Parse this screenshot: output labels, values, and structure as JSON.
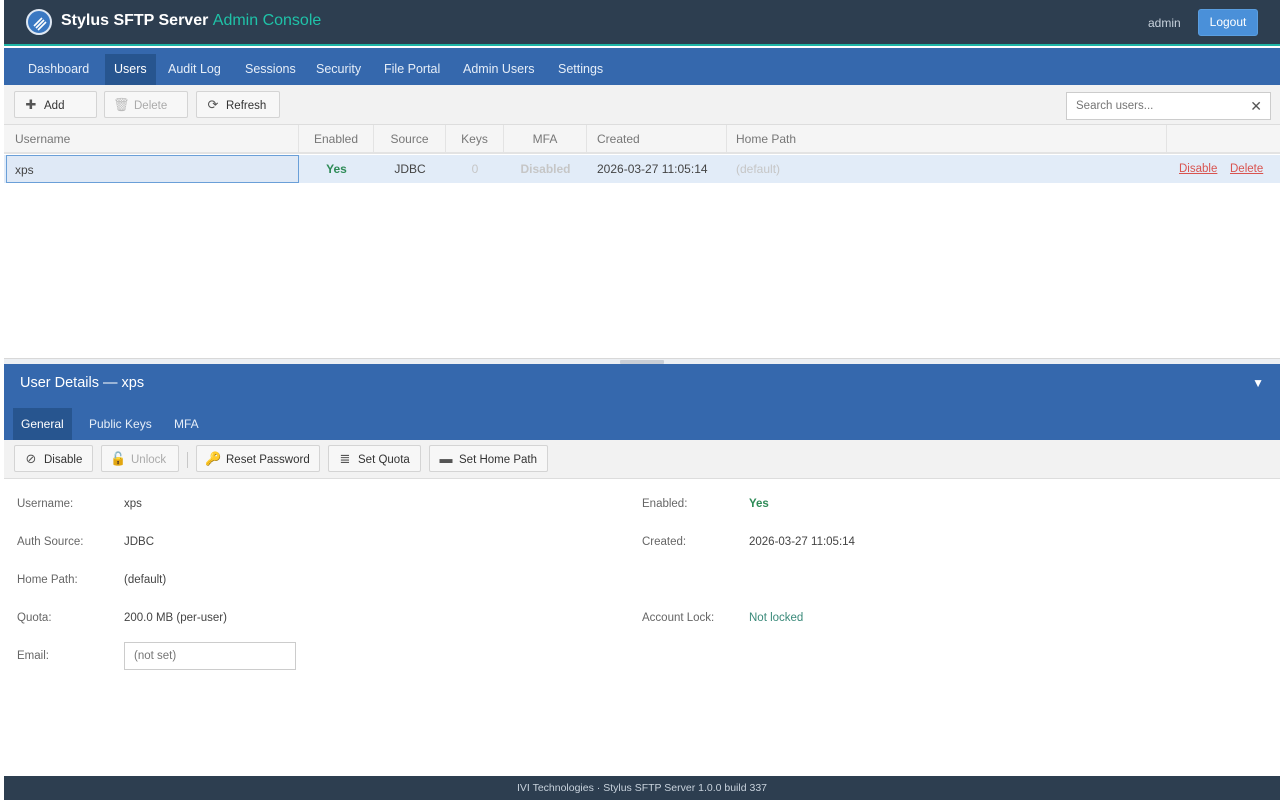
{
  "header": {
    "title": "Stylus SFTP Server",
    "subtitle": "Admin Console",
    "user": "admin",
    "logout_label": "Logout",
    "logo_icon": "sftp-logo-icon"
  },
  "nav": {
    "tabs": [
      {
        "label": "Dashboard"
      },
      {
        "label": "Users",
        "active": true
      },
      {
        "label": "Audit Log"
      },
      {
        "label": "Sessions"
      },
      {
        "label": "Security"
      },
      {
        "label": "File Portal"
      },
      {
        "label": "Admin Users"
      },
      {
        "label": "Settings"
      }
    ]
  },
  "toolbar": {
    "add_label": "Add",
    "delete_label": "Delete",
    "refresh_label": "Refresh",
    "search_placeholder": "Search users...",
    "search_value": ""
  },
  "table": {
    "columns": [
      "Username",
      "Enabled",
      "Source",
      "Keys",
      "MFA",
      "Created",
      "Home Path"
    ],
    "rows": [
      {
        "username": "xps",
        "enabled": "Yes",
        "source": "JDBC",
        "keys": "0",
        "mfa": "Disabled",
        "created": "2026-03-27 11:05:14",
        "home_path": "(default)",
        "action_disable": "Disable",
        "action_delete": "Delete"
      }
    ]
  },
  "details": {
    "title": "User Details — xps",
    "tabs": [
      {
        "label": "General",
        "active": true
      },
      {
        "label": "Public Keys"
      },
      {
        "label": "MFA"
      }
    ],
    "actions": {
      "disable": "Disable",
      "unlock": "Unlock",
      "reset_password": "Reset Password",
      "set_quota": "Set Quota",
      "set_home_path": "Set Home Path"
    },
    "fields": {
      "username_label": "Username:",
      "username": "xps",
      "auth_source_label": "Auth Source:",
      "auth_source": "JDBC",
      "home_path_label": "Home Path:",
      "home_path": "(default)",
      "quota_label": "Quota:",
      "quota": "200.0 MB (per-user)",
      "email_label": "Email:",
      "email_placeholder": "(not set)",
      "enabled_label": "Enabled:",
      "enabled": "Yes",
      "created_label": "Created:",
      "created": "2026-03-27 11:05:14",
      "account_lock_label": "Account Lock:",
      "account_lock": "Not locked"
    }
  },
  "footer": {
    "text": "IVI Technologies  ·  Stylus SFTP Server 1.0.0 build 337"
  },
  "colors": {
    "header_bg": "#2d3e50",
    "nav_bg": "#3568ad",
    "accent_teal": "#1fc2a8",
    "enabled_green": "#2e8b57",
    "action_red": "#d9534f"
  }
}
